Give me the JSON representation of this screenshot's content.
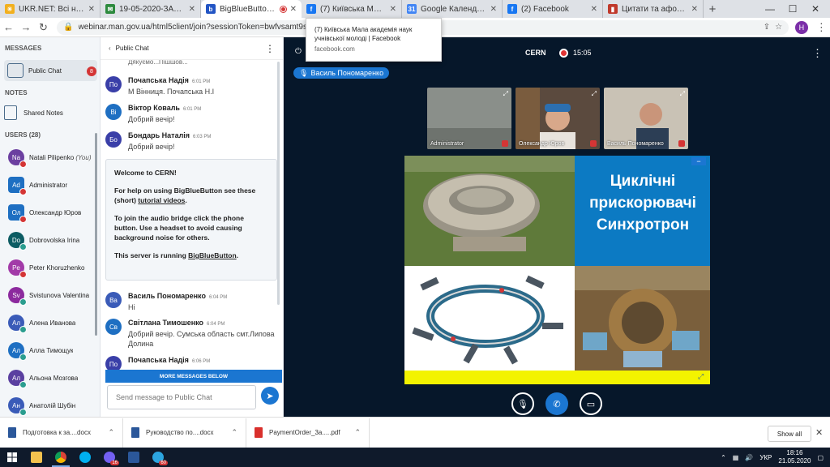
{
  "browser": {
    "tabs": [
      {
        "title": "UKR.NET: Всі новини У",
        "color": "#f2b01e",
        "glyph": "☀",
        "active": false
      },
      {
        "title": "19-05-2020-ЗАПРОШЕ",
        "color": "#2d8a3e",
        "glyph": "✉",
        "active": false
      },
      {
        "title": "BigBlueButton - CE",
        "color": "#2355c4",
        "glyph": "b",
        "active": true
      },
      {
        "title": "(7) Київська Мала ака",
        "color": "#1877f2",
        "glyph": "f",
        "active": false
      },
      {
        "title": "Google Календарь - к",
        "color": "#4285f4",
        "glyph": "31",
        "active": false
      },
      {
        "title": "(2) Facebook",
        "color": "#1877f2",
        "glyph": "f",
        "active": false
      },
      {
        "title": "Цитати та афоризми",
        "color": "#c0392b",
        "glyph": "▮",
        "active": false
      }
    ],
    "url": "webinar.man.gov.ua/html5client/join?sessionToken=bwfvsamt9sylfn",
    "profile_initial": "H"
  },
  "tooltip": {
    "title": "(7) Київська Мала академія наук учнівської молоді | Facebook",
    "domain": "facebook.com"
  },
  "nav": {
    "messages_header": "MESSAGES",
    "public_chat_label": "Public Chat",
    "public_chat_badge": "8",
    "notes_header": "NOTES",
    "shared_notes_label": "Shared Notes",
    "users_header": "USERS (28)",
    "users": [
      {
        "initials": "Na",
        "name": "Natali Pilipenko",
        "you": "(You)",
        "color": "#6b3fa0",
        "mic": "#d43535",
        "round": true
      },
      {
        "initials": "Ad",
        "name": "Administrator",
        "you": "",
        "color": "#1e6fc2",
        "mic": "#d43535",
        "round": false
      },
      {
        "initials": "Ол",
        "name": "Олександр Юров",
        "you": "",
        "color": "#1e6fc2",
        "mic": "#d43535",
        "round": false
      },
      {
        "initials": "Do",
        "name": "Dobrovolska Irina",
        "you": "",
        "color": "#0d5c63",
        "mic": "#2a9d8f",
        "round": true
      },
      {
        "initials": "Pe",
        "name": "Peter Khoruzhenko",
        "you": "",
        "color": "#a23aa8",
        "mic": "#d43535",
        "round": true
      },
      {
        "initials": "Sv",
        "name": "Svistunova Valentina",
        "you": "",
        "color": "#8c2a9e",
        "mic": "#2a9d8f",
        "round": true
      },
      {
        "initials": "Ал",
        "name": "Алена Иванова",
        "you": "",
        "color": "#3a5bb8",
        "mic": "#2a9d8f",
        "round": true
      },
      {
        "initials": "Ал",
        "name": "Алла Тимощук",
        "you": "",
        "color": "#1e6fc2",
        "mic": "#2a9d8f",
        "round": true
      },
      {
        "initials": "Ал",
        "name": "Альона Мозгова",
        "you": "",
        "color": "#5a3fa0",
        "mic": "#2a9d8f",
        "round": true
      },
      {
        "initials": "Ан",
        "name": "Анатолій Шубін",
        "you": "",
        "color": "#3a5bb8",
        "mic": "#2a9d8f",
        "round": true
      }
    ]
  },
  "chat": {
    "header_title": "Public Chat",
    "partial_top": "Дякуємо...Пішшов...",
    "messages_top": [
      {
        "initials": "По",
        "name": "Почапська Надія",
        "time": "6:01 PM",
        "text": "М Вінниця. Почапська Н.І",
        "color": "#3a3fa8"
      },
      {
        "initials": "Ві",
        "name": "Віктор Коваль",
        "time": "6:01 PM",
        "text": "Добрий вечір!",
        "color": "#1e6fc2"
      },
      {
        "initials": "Бо",
        "name": "Бондарь Наталія",
        "time": "6:03 PM",
        "text": "Добрий вечір!",
        "color": "#3a3fa8"
      }
    ],
    "welcome": {
      "line1": "Welcome to CERN!",
      "line2a": "For help on using BigBlueButton see these (short) ",
      "line2link": "tutorial videos",
      "line2b": ".",
      "line3": "To join the audio bridge click the phone button. Use a headset to avoid causing background noise for others.",
      "line4a": "This server is running ",
      "line4link": "BigBlueButton",
      "line4b": "."
    },
    "messages_bottom": [
      {
        "initials": "Ва",
        "name": "Василь Пономаренко",
        "time": "6:04 PM",
        "text": "Ні",
        "color": "#3a5bb8"
      },
      {
        "initials": "Св",
        "name": "Світлана Тимошенко",
        "time": "6:04 PM",
        "text": "Добрий вечір. Сумська область смт.Липова Долина",
        "color": "#1e6fc2"
      },
      {
        "initials": "По",
        "name": "Почапська Надія",
        "time": "6:06 PM",
        "text": "",
        "color": "#3a3fa8"
      }
    ],
    "more_below": "MORE MESSAGES BELOW",
    "input_placeholder": "Send message to Public Chat"
  },
  "stage": {
    "room": "CERN",
    "timer": "15:05",
    "talker": "Василь Пономаренко",
    "cams": [
      {
        "label": "Administrator",
        "color": "#8a8f8a"
      },
      {
        "label": "Олександр Юров",
        "color": "#5b4a3e"
      },
      {
        "label": "Василь Пономаренко",
        "color": "#c9c2b5"
      }
    ],
    "slide_title": "Циклічні прискорювачі Синхротрон",
    "colors": {
      "bg": "#06172a",
      "accent": "#1b76d1",
      "slide_blue": "#0c7ac3",
      "slide_yellow": "#f3f300"
    }
  },
  "downloads": {
    "items": [
      {
        "name": "Подготовка к за....docx",
        "color": "#2b579a"
      },
      {
        "name": "Руководство по....docx",
        "color": "#2b579a"
      },
      {
        "name": "PaymentOrder_3a.....pdf",
        "color": "#d9302c"
      }
    ],
    "show_all": "Show all"
  },
  "taskbar": {
    "lang": "УКР",
    "time": "18:16",
    "date": "21.05.2020",
    "viber_badge": "16",
    "telegram_badge": "60"
  }
}
